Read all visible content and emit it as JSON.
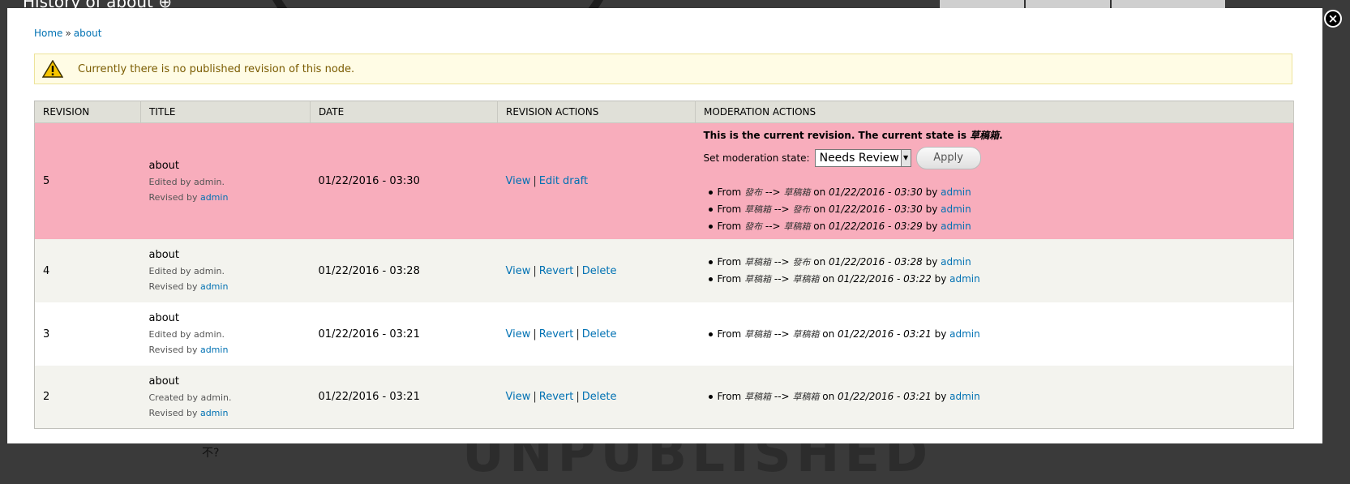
{
  "background": {
    "page_title": "History of about",
    "watermark": "UNPUBLISHED",
    "glyph": "不?"
  },
  "dialog": {
    "close_label": "×"
  },
  "breadcrumb": {
    "home": "Home",
    "separator": "»",
    "current": "about"
  },
  "warning": {
    "message": "Currently there is no published revision of this node."
  },
  "table": {
    "headers": [
      "REVISION",
      "TITLE",
      "DATE",
      "REVISION ACTIONS",
      "MODERATION ACTIONS"
    ],
    "rows": [
      {
        "revision": "5",
        "title": "about",
        "edited": "Edited by admin.",
        "revised_prefix": "Revised by",
        "revised_user": "admin",
        "date": "01/22/2016 - 03:30",
        "actions": [
          "View",
          "Edit draft"
        ],
        "moderation": {
          "current_text": "This is the current revision. The current state is",
          "current_state": "草稿箱",
          "set_label": "Set moderation state:",
          "selected_option": "Needs Review",
          "apply_label": "Apply",
          "history": [
            {
              "from": "發布",
              "to": "草稿箱",
              "date": "01/22/2016 - 03:30",
              "by": "admin"
            },
            {
              "from": "草稿箱",
              "to": "發布",
              "date": "01/22/2016 - 03:30",
              "by": "admin"
            },
            {
              "from": "發布",
              "to": "草稿箱",
              "date": "01/22/2016 - 03:29",
              "by": "admin"
            }
          ]
        }
      },
      {
        "revision": "4",
        "title": "about",
        "edited": "Edited by admin.",
        "revised_prefix": "Revised by",
        "revised_user": "admin",
        "date": "01/22/2016 - 03:28",
        "actions": [
          "View",
          "Revert",
          "Delete"
        ],
        "history": [
          {
            "from": "草稿箱",
            "to": "發布",
            "date": "01/22/2016 - 03:28",
            "by": "admin"
          },
          {
            "from": "草稿箱",
            "to": "草稿箱",
            "date": "01/22/2016 - 03:22",
            "by": "admin"
          }
        ]
      },
      {
        "revision": "3",
        "title": "about",
        "edited": "Edited by admin.",
        "revised_prefix": "Revised by",
        "revised_user": "admin",
        "date": "01/22/2016 - 03:21",
        "actions": [
          "View",
          "Revert",
          "Delete"
        ],
        "history": [
          {
            "from": "草稿箱",
            "to": "草稿箱",
            "date": "01/22/2016 - 03:21",
            "by": "admin"
          }
        ]
      },
      {
        "revision": "2",
        "title": "about",
        "edited": "Created by admin.",
        "revised_prefix": "Revised by",
        "revised_user": "admin",
        "date": "01/22/2016 - 03:21",
        "actions": [
          "View",
          "Revert",
          "Delete"
        ],
        "history": [
          {
            "from": "草稿箱",
            "to": "草稿箱",
            "date": "01/22/2016 - 03:21",
            "by": "admin"
          }
        ]
      }
    ],
    "history_words": {
      "from": "From",
      "arrow": "-->",
      "on": "on",
      "by": "by"
    }
  }
}
